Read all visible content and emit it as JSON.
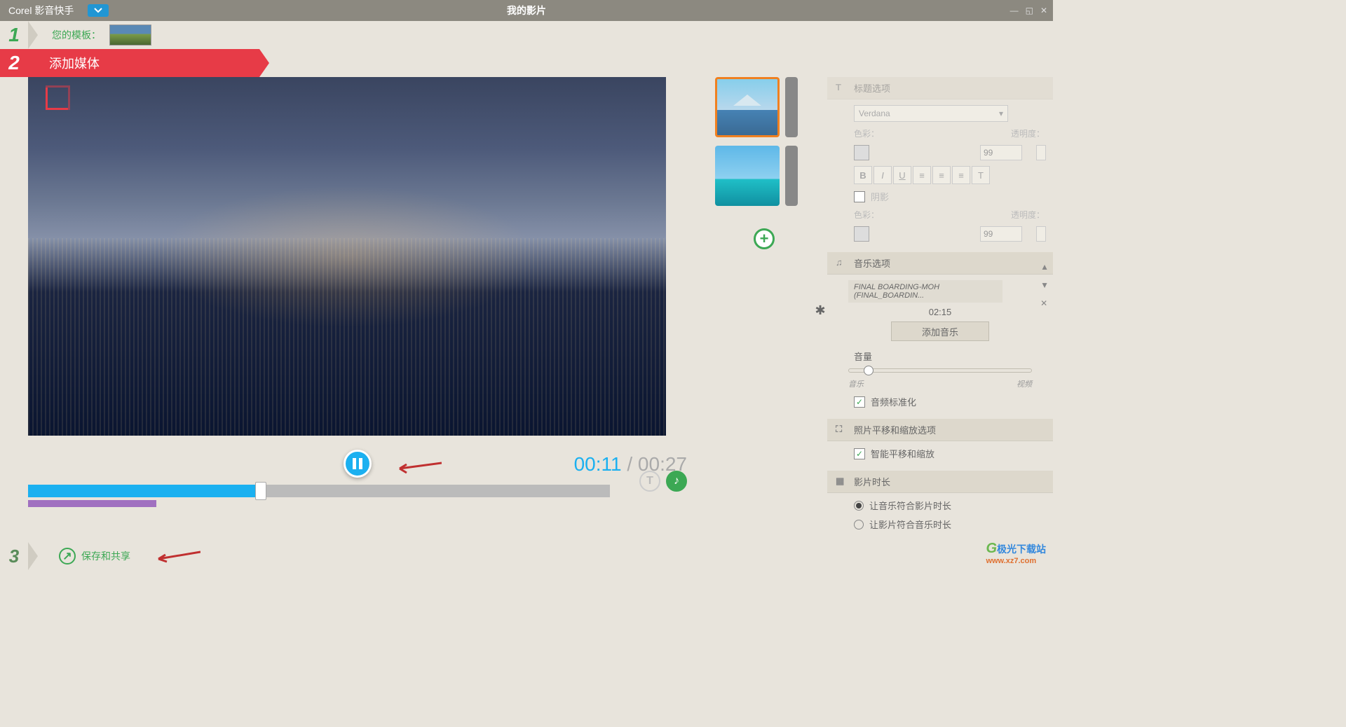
{
  "titlebar": {
    "app_name": "Corel 影音快手",
    "doc_title": "我的影片"
  },
  "step1": {
    "num": "1",
    "label": "您的模板："
  },
  "step2": {
    "num": "2",
    "label": "添加媒体"
  },
  "step3": {
    "num": "3",
    "label": "保存和共享"
  },
  "playback": {
    "current": "00:11",
    "sep": " / ",
    "total": "00:27"
  },
  "right": {
    "title_sec": {
      "header": "标题选项",
      "font": "Verdana",
      "color_label": "色彩：",
      "opacity_label": "透明度：",
      "opacity_value": "99",
      "shadow_label": "阴影",
      "color2_label": "色彩：",
      "opacity2_label": "透明度：",
      "opacity2_value": "99"
    },
    "music_sec": {
      "header": "音乐选项",
      "track": "FINAL BOARDING-MOH (FINAL_BOARDIN...",
      "duration": "02:15",
      "add_btn": "添加音乐",
      "volume_label": "音量",
      "vol_left": "音乐",
      "vol_right": "视频",
      "normalize": "音频标准化"
    },
    "panzoom_sec": {
      "header": "照片平移和缩放选项",
      "smart": "智能平移和缩放"
    },
    "duration_sec": {
      "header": "影片时长",
      "opt1": "让音乐符合影片时长",
      "opt2": "让影片符合音乐时长"
    }
  },
  "watermark": {
    "cn": "极光下载站",
    "url": "www.xz7.com"
  },
  "fmt": {
    "b": "B",
    "i": "I",
    "u": "U"
  }
}
